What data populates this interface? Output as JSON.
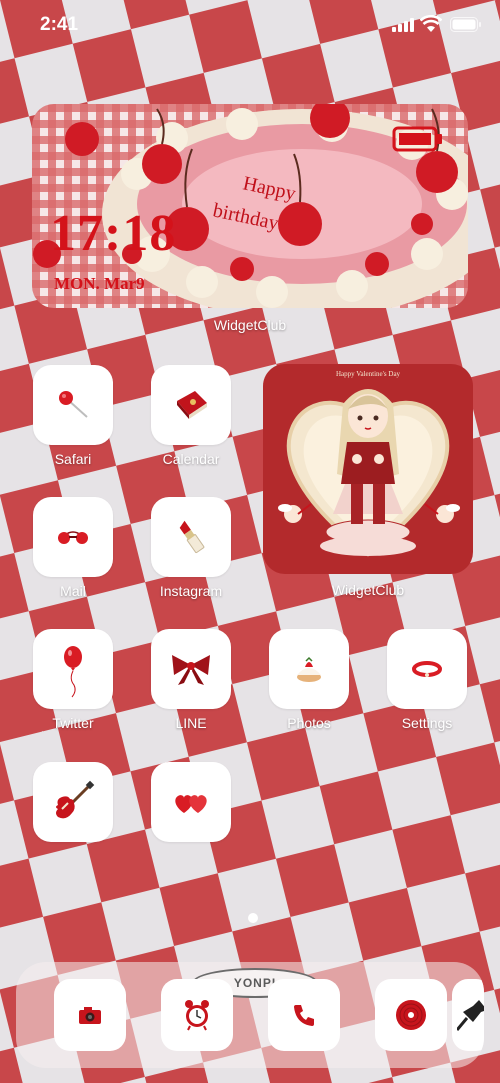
{
  "status_bar": {
    "time": "2:41",
    "signal_icon": "cellular-signal-icon",
    "wifi_icon": "wifi-icon",
    "battery_icon": "battery-icon"
  },
  "widget_top": {
    "time": "17:18",
    "date": "MON. Mar9",
    "caption": "WidgetClub"
  },
  "widget_art": {
    "caption": "WidgetClub",
    "art_text": "Happy Valentine's Day"
  },
  "apps": [
    {
      "label": "Safari",
      "icon": "lollipop-icon"
    },
    {
      "label": "Calendar",
      "icon": "red-book-icon"
    },
    {
      "label": "Mail",
      "icon": "cherry-sunglasses-icon"
    },
    {
      "label": "Instagram",
      "icon": "lipstick-icon"
    },
    {
      "label": "Twitter",
      "icon": "red-balloon-icon"
    },
    {
      "label": "LINE",
      "icon": "red-bow-icon"
    },
    {
      "label": "Photos",
      "icon": "strawberry-cake-icon"
    },
    {
      "label": "Settings",
      "icon": "red-bracelet-icon"
    },
    {
      "label": "",
      "icon": "electric-guitar-icon"
    },
    {
      "label": "",
      "icon": "heart-cookies-icon"
    }
  ],
  "dock": {
    "banner_text": "YONPI",
    "items": [
      {
        "icon": "red-camera-icon"
      },
      {
        "icon": "alarm-clock-icon"
      },
      {
        "icon": "telephone-icon"
      },
      {
        "icon": "vinyl-record-icon"
      }
    ]
  },
  "colors": {
    "check_red": "#c8474a",
    "check_white": "#e6e3e6",
    "accent_red": "#d4121a"
  }
}
